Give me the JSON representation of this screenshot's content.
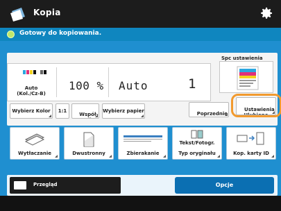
{
  "title": "Kopia",
  "status_text": "Gotowy do kopiowania.",
  "status_box": {
    "color_value": "Auto\n(Kol./Cz-B)",
    "scale": "100 %",
    "paper": "Auto",
    "copies": "1"
  },
  "settings_buttons": [
    {
      "name": "select-color-button",
      "label": "Wybierz Kolor"
    },
    {
      "name": "one-to-one-button",
      "label": "1:1"
    },
    {
      "name": "copy-ratio-button",
      "label": "Współ-\nczynnik..."
    },
    {
      "name": "select-paper-button",
      "label": "Wybierz papier"
    },
    {
      "name": "previous-settings-button",
      "label": "Poprzednie\nUstawienia"
    },
    {
      "name": "favorite-settings-button",
      "label": "Ustawienia\nUlubione"
    }
  ],
  "spec_settings_label": "Spc ustawienia",
  "functions": [
    {
      "name": "two-sided-button",
      "label": "Wytłaczanie",
      "icon": "two-sided-icon"
    },
    {
      "name": "density-button",
      "label": "Dwustronny",
      "icon": "density-icon"
    },
    {
      "name": "zoom-button",
      "label": "Zbierakanie",
      "icon": "zoom-icon"
    },
    {
      "name": "original-type-button",
      "label": "Typ oryginału",
      "sub": "Tekst/Fotogr.",
      "icon": "original-type-icon"
    },
    {
      "name": "id-card-copy-button",
      "label": "Kop. karty ID",
      "icon": "id-card-icon"
    }
  ],
  "preview_label": "Przegląd",
  "start_label": "Opcje",
  "colors": {
    "title_bar": "#1c1c1c",
    "status_bar": "#0f86bf",
    "panel_blue": "#1f8fd0",
    "highlight": "#f29a2e"
  }
}
